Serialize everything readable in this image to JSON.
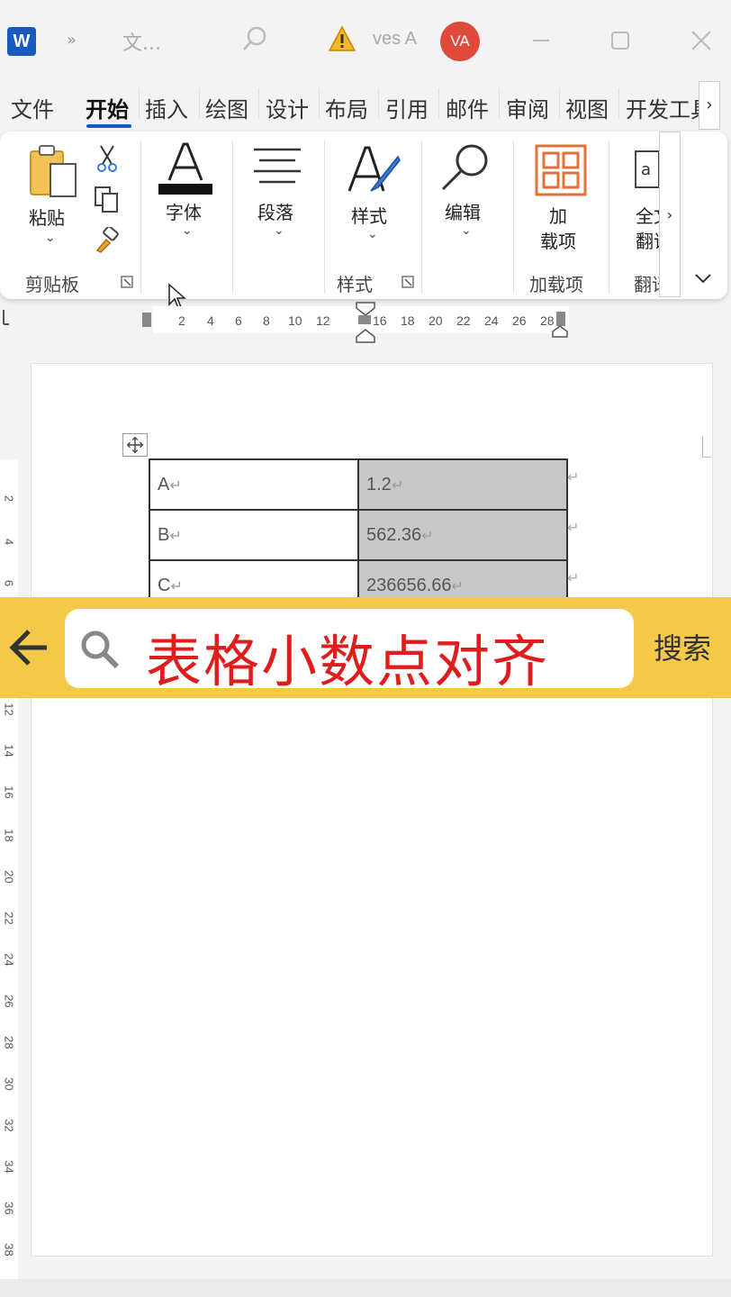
{
  "titlebar": {
    "app_logo": "W",
    "qat_more": "»",
    "doc_title": "文...",
    "user_name": "ves A",
    "avatar_initials": "VA"
  },
  "tabs": [
    {
      "label": "文件"
    },
    {
      "label": "开始"
    },
    {
      "label": "插入"
    },
    {
      "label": "绘图"
    },
    {
      "label": "设计"
    },
    {
      "label": "布局"
    },
    {
      "label": "引用"
    },
    {
      "label": "邮件"
    },
    {
      "label": "审阅"
    },
    {
      "label": "视图"
    },
    {
      "label": "开发工具"
    }
  ],
  "tab_scroll": "›",
  "ribbon": {
    "paste": "粘贴",
    "clipboard_group": "剪贴板",
    "font": "字体",
    "paragraph": "段落",
    "styles": "样式",
    "styles_group": "样式",
    "editing": "编辑",
    "addins_line1": "加",
    "addins_line2": "载项",
    "addins_group": "加载项",
    "translate_line1": "全文",
    "translate_line2": "翻译",
    "translate_group": "翻译",
    "scroll": "›"
  },
  "ruler_h": [
    "2",
    "4",
    "6",
    "8",
    "10",
    "12",
    "16",
    "18",
    "20",
    "22",
    "24",
    "26",
    "28"
  ],
  "ruler_v": [
    "2",
    "4",
    "6",
    "12",
    "14",
    "16",
    "18",
    "20",
    "22",
    "24",
    "26",
    "28",
    "30",
    "32",
    "34",
    "36",
    "38"
  ],
  "table": {
    "rows": [
      {
        "label": "A",
        "value": "1.2"
      },
      {
        "label": "B",
        "value": "562.36"
      },
      {
        "label": "C",
        "value": "236656.66"
      }
    ],
    "para_mark": "↵",
    "row_end_mark": "↵"
  },
  "search": {
    "query": "表格小数点对齐",
    "button": "搜索"
  },
  "colors": {
    "word_blue": "#185abd",
    "avatar": "#e04a3a",
    "search_bar": "#f4c94a",
    "query_text": "#e01c1c",
    "cell_highlight": "#c8c8c8"
  }
}
